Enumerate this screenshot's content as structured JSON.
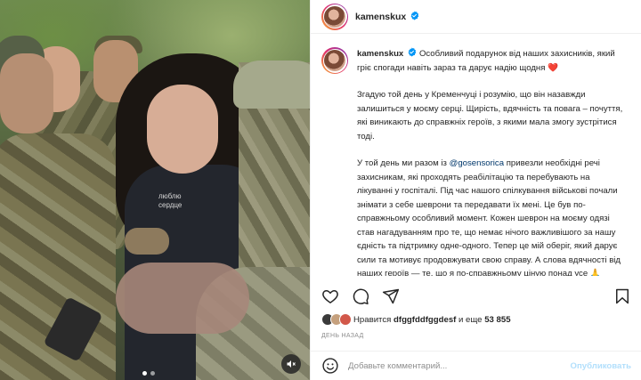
{
  "post": {
    "username": "kamenskux",
    "verified": true
  },
  "caption": {
    "username": "kamenskux",
    "p1": "Особливий подарунок від наших захисників, який гріє спогади навіть зараз та дарує надію щодня",
    "p1_emoji": "❤️",
    "p2": "Згадую той день у Кременчуці і розумію, що він назавжди залишиться у моєму серці. Щирість, вдячність та повага – почуття, які виникають до справжніх героїв, з якими мала змогу зустрітися тоді.",
    "p3_before": "У той день ми разом із ",
    "p3_mention": "@gosensorica",
    "p3_after": " привезли необхідні речі захисникам, які проходять реабілітацію та перебувають на лікуванні у госпіталі. Під час нашого спілкування військові почали знімати з себе шеврони та передавати їх мені. Це був по-справжньому особливий момент. Кожен шеврон на моєму одязі став нагадуванням про те, що немає нічого важливішого за нашу єдність та підтримку одне-одного. Тепер це мій оберіг, який дарує сили та мотивує продовжувати свою справу. А слова вдячності від наших героїв — те, що я по-справжньому ціную понад усе",
    "p3_emoji": "🙏"
  },
  "media": {
    "shirt_print": "люблю\nсердце",
    "dots_total": 2,
    "dots_active": 0
  },
  "likes": {
    "prefix": "Нравится",
    "user": "dfggfddfggdesf",
    "middle": "и еще",
    "count": "53 855"
  },
  "timestamp": "ДЕНЬ НАЗАД",
  "comment": {
    "placeholder": "Добавьте комментарий...",
    "publish_label": "Опубликовать"
  },
  "icons": {
    "heart": "heart-outline-icon",
    "comment": "comment-bubble-icon",
    "share": "paper-plane-icon",
    "save": "bookmark-icon",
    "emoji": "smiley-icon",
    "mute": "speaker-muted-icon"
  },
  "colors": {
    "verified_blue": "#0095f6",
    "publish_disabled": "#b2dffc",
    "mention": "#00376b"
  }
}
